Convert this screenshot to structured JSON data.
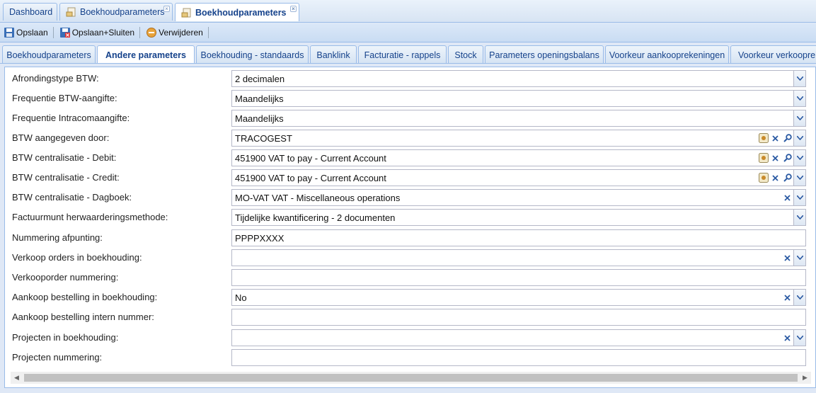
{
  "window_tabs": [
    {
      "label": "Dashboard"
    },
    {
      "label": "Boekhoudparameters"
    },
    {
      "label": "Boekhoudparameters"
    }
  ],
  "toolbar": {
    "save_label": "Opslaan",
    "save_close_label": "Opslaan+Sluiten",
    "delete_label": "Verwijderen"
  },
  "sub_tabs": [
    {
      "label": "Boekhoudparameters"
    },
    {
      "label": "Andere parameters"
    },
    {
      "label": "Boekhouding - standaards"
    },
    {
      "label": "Banklink"
    },
    {
      "label": "Facturatie - rappels"
    },
    {
      "label": "Stock"
    },
    {
      "label": "Parameters openingsbalans"
    },
    {
      "label": "Voorkeur aankooprekeningen"
    },
    {
      "label": "Voorkeur verkooprek"
    }
  ],
  "form": {
    "rows": [
      {
        "label": "Afrondingstype BTW:",
        "value": "2 decimalen"
      },
      {
        "label": "Frequentie BTW-aangifte:",
        "value": "Maandelijks"
      },
      {
        "label": "Frequentie Intracomaangifte:",
        "value": "Maandelijks"
      },
      {
        "label": "BTW aangegeven door:",
        "value": "TRACOGEST"
      },
      {
        "label": "BTW centralisatie - Debit:",
        "value": "451900 VAT to pay - Current Account"
      },
      {
        "label": "BTW centralisatie - Credit:",
        "value": "451900 VAT to pay - Current Account"
      },
      {
        "label": "BTW centralisatie - Dagboek:",
        "value": "MO-VAT VAT - Miscellaneous operations"
      },
      {
        "label": "Factuurmunt herwaarderingsmethode:",
        "value": "Tijdelijke kwantificering - 2 documenten"
      },
      {
        "label": "Nummering afpunting:",
        "value": "PPPPXXXX"
      },
      {
        "label": "Verkoop orders in boekhouding:",
        "value": ""
      },
      {
        "label": "Verkooporder nummering:",
        "value": ""
      },
      {
        "label": "Aankoop bestelling in boekhouding:",
        "value": "No"
      },
      {
        "label": "Aankoop bestelling intern nummer:",
        "value": ""
      },
      {
        "label": "Projecten in boekhouding:",
        "value": ""
      },
      {
        "label": "Projecten nummering:",
        "value": ""
      }
    ]
  },
  "colors": {
    "tab_text": "#15428b",
    "border": "#99bbe8",
    "background": "#dfe8f6"
  }
}
